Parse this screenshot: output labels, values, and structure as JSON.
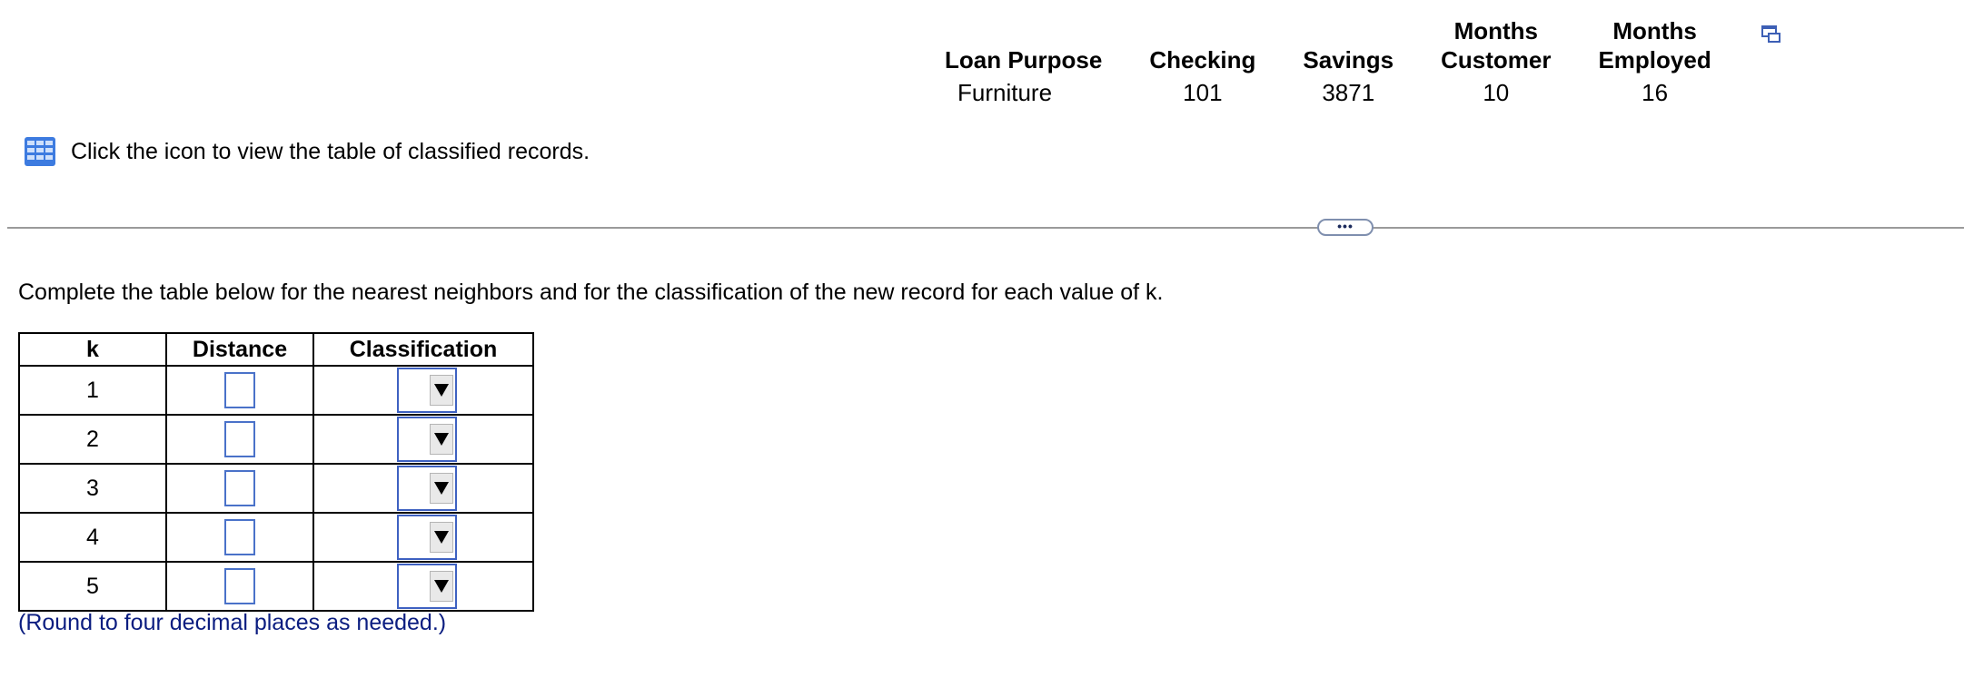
{
  "record": {
    "headers": [
      {
        "line1": "",
        "line2": "Loan Purpose"
      },
      {
        "line1": "",
        "line2": "Checking"
      },
      {
        "line1": "",
        "line2": "Savings"
      },
      {
        "line1": "Months",
        "line2": "Customer"
      },
      {
        "line1": "Months",
        "line2": "Employed"
      }
    ],
    "values": [
      "Furniture",
      "101",
      "3871",
      "10",
      "16"
    ],
    "popout_icon": "popout-icon"
  },
  "link": {
    "icon": "table-grid-icon",
    "text": "Click the icon to view the table of classified records."
  },
  "divider": {
    "expand_icon": "ellipsis-icon",
    "expand_label": "•••"
  },
  "instruction": "Complete the table below for the nearest neighbors and for the classification of the new record for each value of k.",
  "answer_table": {
    "headers": [
      "k",
      "Distance",
      "Classification"
    ],
    "rows": [
      {
        "k": "1",
        "distance": "",
        "classification": ""
      },
      {
        "k": "2",
        "distance": "",
        "classification": ""
      },
      {
        "k": "3",
        "distance": "",
        "classification": ""
      },
      {
        "k": "4",
        "distance": "",
        "classification": ""
      },
      {
        "k": "5",
        "distance": "",
        "classification": ""
      }
    ]
  },
  "note": "(Round to four decimal places as needed.)",
  "colors": {
    "accent_blue": "#4a72c9",
    "note_blue": "#0b1d80",
    "icon_blue": "#3d7be0"
  }
}
